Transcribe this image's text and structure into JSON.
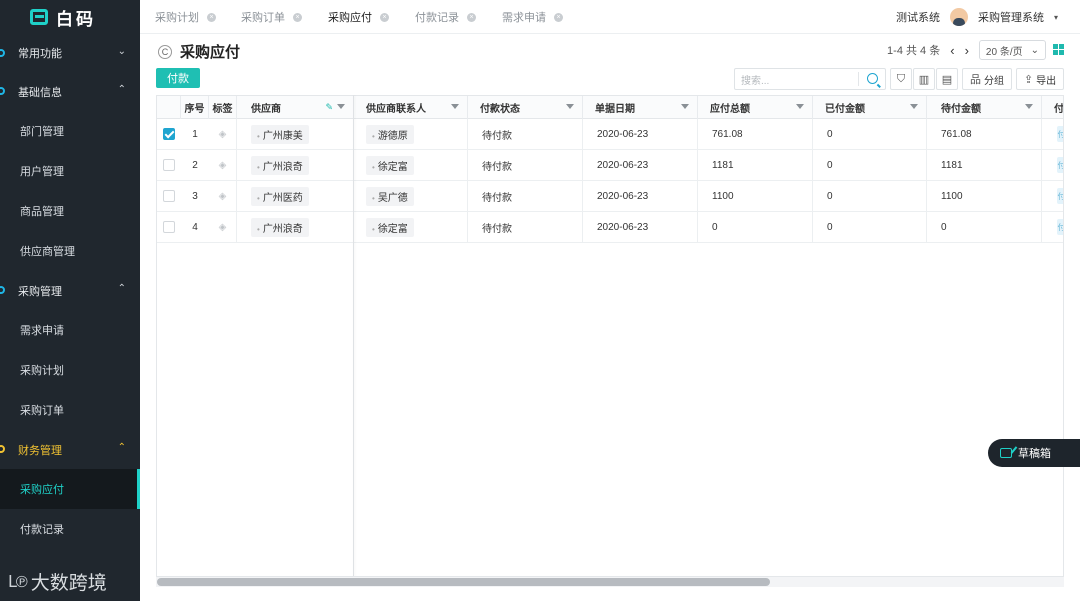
{
  "brand": {
    "name": "白码"
  },
  "sidebar": {
    "groups": [
      {
        "label": "常用功能",
        "chevron": "⌄"
      },
      {
        "label": "基础信息",
        "chevron": "⌃",
        "items": [
          "部门管理",
          "用户管理",
          "商品管理",
          "供应商管理"
        ]
      },
      {
        "label": "采购管理",
        "chevron": "⌃",
        "items": [
          "需求申请",
          "采购计划",
          "采购订单"
        ]
      },
      {
        "label": "财务管理",
        "chevron": "⌃",
        "items": [
          "采购应付",
          "付款记录"
        ]
      }
    ],
    "current_item": "采购应付",
    "active_group": "财务管理"
  },
  "watermark": {
    "logo": "ᒪ℗",
    "text": "大数跨境"
  },
  "tabs": [
    {
      "label": "采购计划",
      "close": "×"
    },
    {
      "label": "采购订单",
      "close": "×"
    },
    {
      "label": "采购应付",
      "close": "×",
      "active": true
    },
    {
      "label": "付款记录",
      "close": "×"
    },
    {
      "label": "需求申请",
      "close": "×"
    }
  ],
  "topbar": {
    "system_label": "测试系统",
    "app_name": "采购管理系统",
    "caret": "▾"
  },
  "page": {
    "title": "采购应付",
    "refresh_icon": "C"
  },
  "pager": {
    "range": "1-4 共 4 条",
    "prev": "‹",
    "next": "›",
    "page_size": "20 条/页",
    "page_size_caret": "⌄"
  },
  "toolbar": {
    "pay_label": "付款",
    "search_placeholder": "搜索...",
    "filter_icon": "⛉",
    "chart_icon": "▥",
    "columns_icon": "▤",
    "group_label": "分组",
    "group_icon": "品",
    "export_label": "导出",
    "export_icon": "⇪"
  },
  "table": {
    "columns": [
      "序号",
      "标签",
      "供应商",
      "供应商联系人",
      "付款状态",
      "单据日期",
      "应付总额",
      "已付金额",
      "待付金额",
      "付"
    ],
    "rows": [
      {
        "checked": true,
        "index": "1",
        "supplier": "广州康美",
        "contact": "游德原",
        "status": "待付款",
        "date": "2020-06-23",
        "total": "761.08",
        "paid": "0",
        "pending": "761.08"
      },
      {
        "checked": false,
        "index": "2",
        "supplier": "广州浪奇",
        "contact": "徐定富",
        "status": "待付款",
        "date": "2020-06-23",
        "total": "1181",
        "paid": "0",
        "pending": "1181"
      },
      {
        "checked": false,
        "index": "3",
        "supplier": "广州医药",
        "contact": "吴广德",
        "status": "待付款",
        "date": "2020-06-23",
        "total": "1100",
        "paid": "0",
        "pending": "1100"
      },
      {
        "checked": false,
        "index": "4",
        "supplier": "广州浪奇",
        "contact": "徐定富",
        "status": "待付款",
        "date": "2020-06-23",
        "total": "0",
        "paid": "0",
        "pending": "0"
      }
    ],
    "tag_icon": "◈",
    "last_col_badge": "付"
  },
  "draft": {
    "label": "草稿箱"
  },
  "colors": {
    "accent": "#1fbfb3",
    "sidebar_bg": "#20272e",
    "active_group": "#f1c232",
    "link_blue": "#1fa5d0"
  }
}
